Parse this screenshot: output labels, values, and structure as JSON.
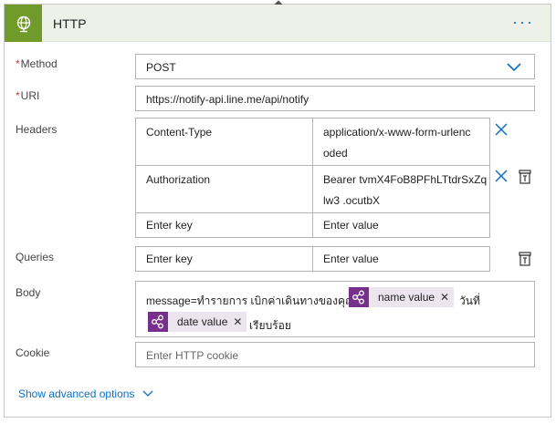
{
  "header": {
    "title": "HTTP",
    "more": "···"
  },
  "method": {
    "label": "Method",
    "value": "POST"
  },
  "uri": {
    "label": "URI",
    "value": "https://notify-api.line.me/api/notify"
  },
  "headers": {
    "label": "Headers",
    "rows": [
      {
        "key": "Content-Type",
        "value_line1": "application/x-www-form-urlenc",
        "value_line2": "oded"
      },
      {
        "key": "Authorization",
        "value_line1": "Bearer tvmX4FoB8PFhLTtdrSxZq",
        "value_line2": "lw3                    .ocutbX"
      }
    ],
    "key_placeholder": "Enter key",
    "value_placeholder": "Enter value"
  },
  "queries": {
    "label": "Queries",
    "key_placeholder": "Enter key",
    "value_placeholder": "Enter value"
  },
  "body": {
    "label": "Body",
    "text1": "message=ทำรายการ เบิกค่าเดินทางของคุณ",
    "token1": "name value",
    "text2": "วันที่",
    "token2": "date value",
    "text3": "เรียบร้อย"
  },
  "cookie": {
    "label": "Cookie",
    "placeholder": "Enter HTTP cookie"
  },
  "advanced": {
    "label": "Show advanced options"
  },
  "colors": {
    "accent": "#0e6fc4",
    "header_icon_bg": "#709b2a",
    "token_icon_bg": "#772f8c",
    "required": "#c63b3b"
  }
}
